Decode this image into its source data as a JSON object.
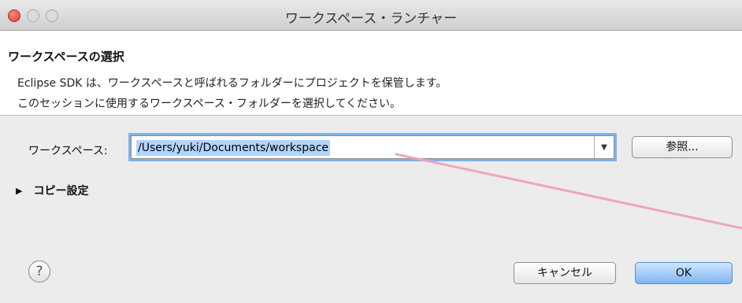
{
  "window": {
    "title": "ワークスペース・ランチャー"
  },
  "header": {
    "title": "ワークスペースの選択",
    "line1": "Eclipse SDK は、ワークスペースと呼ばれるフォルダーにプロジェクトを保管します。",
    "line2": "このセッションに使用するワークスペース・フォルダーを選択してください。"
  },
  "workspace": {
    "label": "ワークスペース:",
    "value": "/Users/yuki/Documents/workspace",
    "browse_label": "参照..."
  },
  "copy_settings": {
    "label": "コピー設定"
  },
  "footer": {
    "help_symbol": "?",
    "cancel_label": "キャンセル",
    "ok_label": "OK"
  },
  "colors": {
    "selection": "#b3d4fd",
    "focus_ring": "#7fb2e8",
    "ok_button": "#7db6f0",
    "annotation_line": "#f0a3c2"
  }
}
